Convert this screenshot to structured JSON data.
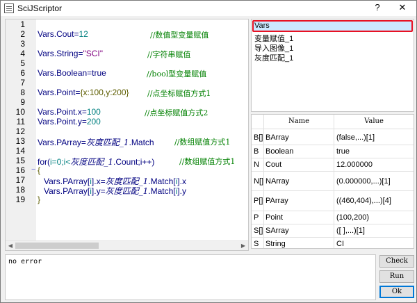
{
  "window": {
    "title": "SciJScriptor",
    "help_label": "?",
    "close_label": "✕"
  },
  "editor": {
    "line_numbers": [
      "1",
      "2",
      "3",
      "4",
      "5",
      "6",
      "7",
      "8",
      "9",
      "10",
      "11",
      "12",
      "13",
      "14",
      "15",
      "16",
      "17",
      "18",
      "19"
    ],
    "fold_marker": "−",
    "lines": {
      "l2": {
        "var": "Vars",
        "rest": ".Cout=",
        "num": "12",
        "comment": "//数值型变量赋值"
      },
      "l4": {
        "var": "Vars",
        "rest": ".String=",
        "str": "\"SCI\"",
        "comment": "//字符串赋值"
      },
      "l6": {
        "var": "Vars",
        "rest": ".Boolean=true",
        "comment": "//bool型变量赋值"
      },
      "l8": {
        "var": "Vars",
        "rest": ".Point=",
        "obj": "{x:100,y:200}",
        "comment": "//点坐标赋值方式1"
      },
      "l10": {
        "var": "Vars",
        "rest": ".Point.x=",
        "num": "100",
        "comment": "//点坐标赋值方式2"
      },
      "l11": {
        "var": "Vars",
        "rest": ".Point.y=",
        "num": "200"
      },
      "l13": {
        "var": "Vars",
        "rest": ".PArray=",
        "cjk": "灰度匹配_1",
        "tail": ".Match",
        "comment": "//数组赋值方式1"
      },
      "l15": {
        "kw": "for(",
        "init": "i=0;i<",
        "cjk": "灰度匹配_1",
        "tail": ".Count;i++)",
        "comment": "//数组赋值方式1"
      },
      "l16": {
        "text": "{"
      },
      "l17": {
        "var": "Vars",
        "pre": ".PArray[",
        "idx": "i",
        "mid": "].x=",
        "cjk": "灰度匹配_1",
        "tail": ".Match[",
        "idx2": "i",
        "end": "].x"
      },
      "l18": {
        "var": "Vars",
        "pre": ".PArray[",
        "idx": "i",
        "mid": "].y=",
        "cjk": "灰度匹配_1",
        "tail": ".Match[",
        "idx2": "i",
        "end": "].y"
      },
      "l19": {
        "text": "}"
      }
    }
  },
  "tree": {
    "items": [
      "Vars",
      "变量赋值_1",
      "导入图像_1",
      "灰度匹配_1"
    ],
    "selected": "Vars"
  },
  "var_table": {
    "columns": [
      "Name",
      "Value"
    ],
    "rows": [
      {
        "type": "B[]",
        "name": "BArray",
        "value": "(false,...)[1]"
      },
      {
        "type": "B",
        "name": "Boolean",
        "value": "true"
      },
      {
        "type": "N",
        "name": "Cout",
        "value": "12.000000"
      },
      {
        "type": "N[]",
        "name": "NArray",
        "value": "(0.000000,...)[1]"
      },
      {
        "type": "P[]",
        "name": "PArray",
        "value": "((460,404),...)[4]"
      },
      {
        "type": "P",
        "name": "Point",
        "value": "(100,200)"
      },
      {
        "type": "S[]",
        "name": "SArray",
        "value": "([ ],...)[1]"
      },
      {
        "type": "S",
        "name": "String",
        "value": "CI"
      }
    ]
  },
  "output": {
    "text": "no error"
  },
  "buttons": {
    "check": "Check",
    "run": "Run",
    "ok": "Ok"
  },
  "colors": {
    "selection_border": "#e81123",
    "selection_fill": "#cce8ff",
    "keyword": "#000080",
    "comment": "#008000"
  }
}
